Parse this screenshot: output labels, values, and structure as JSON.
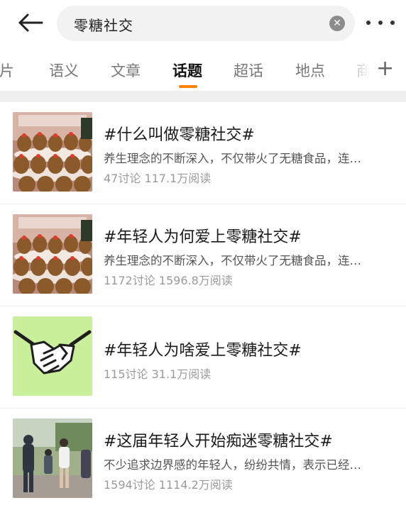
{
  "search": {
    "query": "零糖社交"
  },
  "tabs": [
    {
      "label": "图片"
    },
    {
      "label": "语义"
    },
    {
      "label": "文章"
    },
    {
      "label": "话题"
    },
    {
      "label": "超话"
    },
    {
      "label": "地点"
    },
    {
      "label": "商"
    }
  ],
  "active_tab": "话题",
  "results": [
    {
      "title": "#什么叫做零糖社交#",
      "desc": "养生理念的不断深入，不仅带火了无糖食品，连…",
      "stats": "47讨论 117.1万阅读",
      "thumb": "capybara-plush-display"
    },
    {
      "title": "#年轻人为何爱上零糖社交#",
      "desc": "养生理念的不断深入，不仅带火了无糖食品，连…",
      "stats": "1172讨论 1596.8万阅读",
      "thumb": "capybara-plush-display"
    },
    {
      "title": "#年轻人为啥爱上零糖社交#",
      "desc": "",
      "stats": "115讨论 31.1万阅读",
      "thumb": "handshake-illustration"
    },
    {
      "title": "#这届年轻人开始痴迷零糖社交#",
      "desc": "不少追求边界感的年轻人，纷纷共情，表示已经…",
      "stats": "1594讨论 1114.2万阅读",
      "thumb": "people-outdoor-photo"
    }
  ],
  "colors": {
    "accent": "#ff8200",
    "handshake_bg": "#c9ef9a"
  }
}
